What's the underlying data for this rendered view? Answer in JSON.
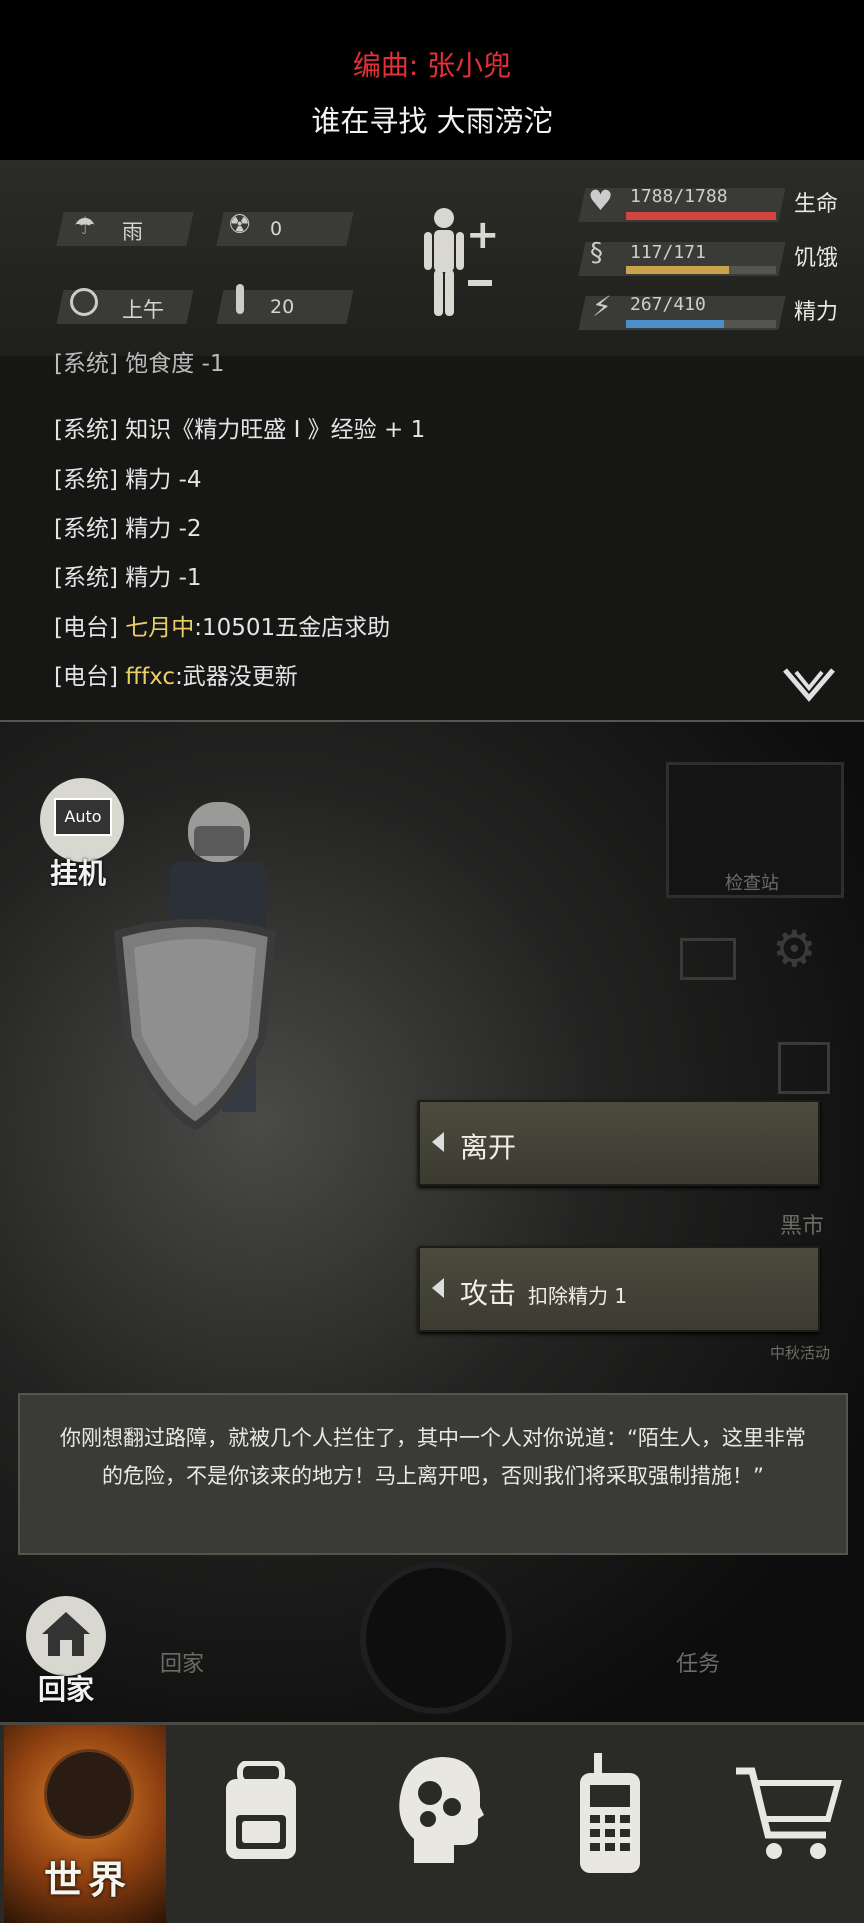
{
  "lyrics": {
    "line1": "编曲: 张小兜",
    "line2": "谁在寻找 大雨滂沱"
  },
  "status": {
    "weather": "雨",
    "radiation": "0",
    "time": "上午",
    "temperature": "20",
    "health": {
      "value": "1788/1788",
      "label": "生命",
      "fraction": 1.0,
      "color": "#d2463f"
    },
    "hunger": {
      "value": "117/171",
      "label": "饥饿",
      "fraction": 0.684,
      "color": "#c9a44c"
    },
    "energy": {
      "value": "267/410",
      "label": "精力",
      "fraction": 0.651,
      "color": "#4a8fc9"
    }
  },
  "log": {
    "partial": "[系统] 饱食度 -1",
    "lines": [
      {
        "tag": "[系统]",
        "text": "知识《精力旺盛 I 》经验 + 1"
      },
      {
        "tag": "[系统]",
        "text": "精力 -4"
      },
      {
        "tag": "[系统]",
        "text": "精力 -2"
      },
      {
        "tag": "[系统]",
        "text": "精力 -1"
      },
      {
        "tag": "[电台]",
        "name": "七月中",
        "text": ":10501五金店求助"
      },
      {
        "tag": "[电台]",
        "name": "fffxc",
        "text": ":武器没更新"
      }
    ]
  },
  "scene": {
    "auto_icon": "Auto",
    "auto_label": "挂机",
    "checkpoint": "检查站",
    "black_market": "黑市",
    "event_label": "中秋活动",
    "choices": [
      {
        "label": "离开",
        "sub": ""
      },
      {
        "label": "攻击",
        "sub": "扣除精力 1"
      }
    ],
    "dialog": "你刚想翻过路障，就被几个人拦住了，其中一个人对你说道：“陌生人，这里非常的危险，不是你该来的地方！马上离开吧，否则我们将采取强制措施！”",
    "home_label": "回家",
    "home_ghost": "回家",
    "task_ghost": "任务"
  },
  "nav": {
    "world_label": "世界",
    "icons": [
      "globe-icon",
      "backpack-icon",
      "brain-icon",
      "walkie-talkie-icon",
      "cart-icon"
    ]
  }
}
